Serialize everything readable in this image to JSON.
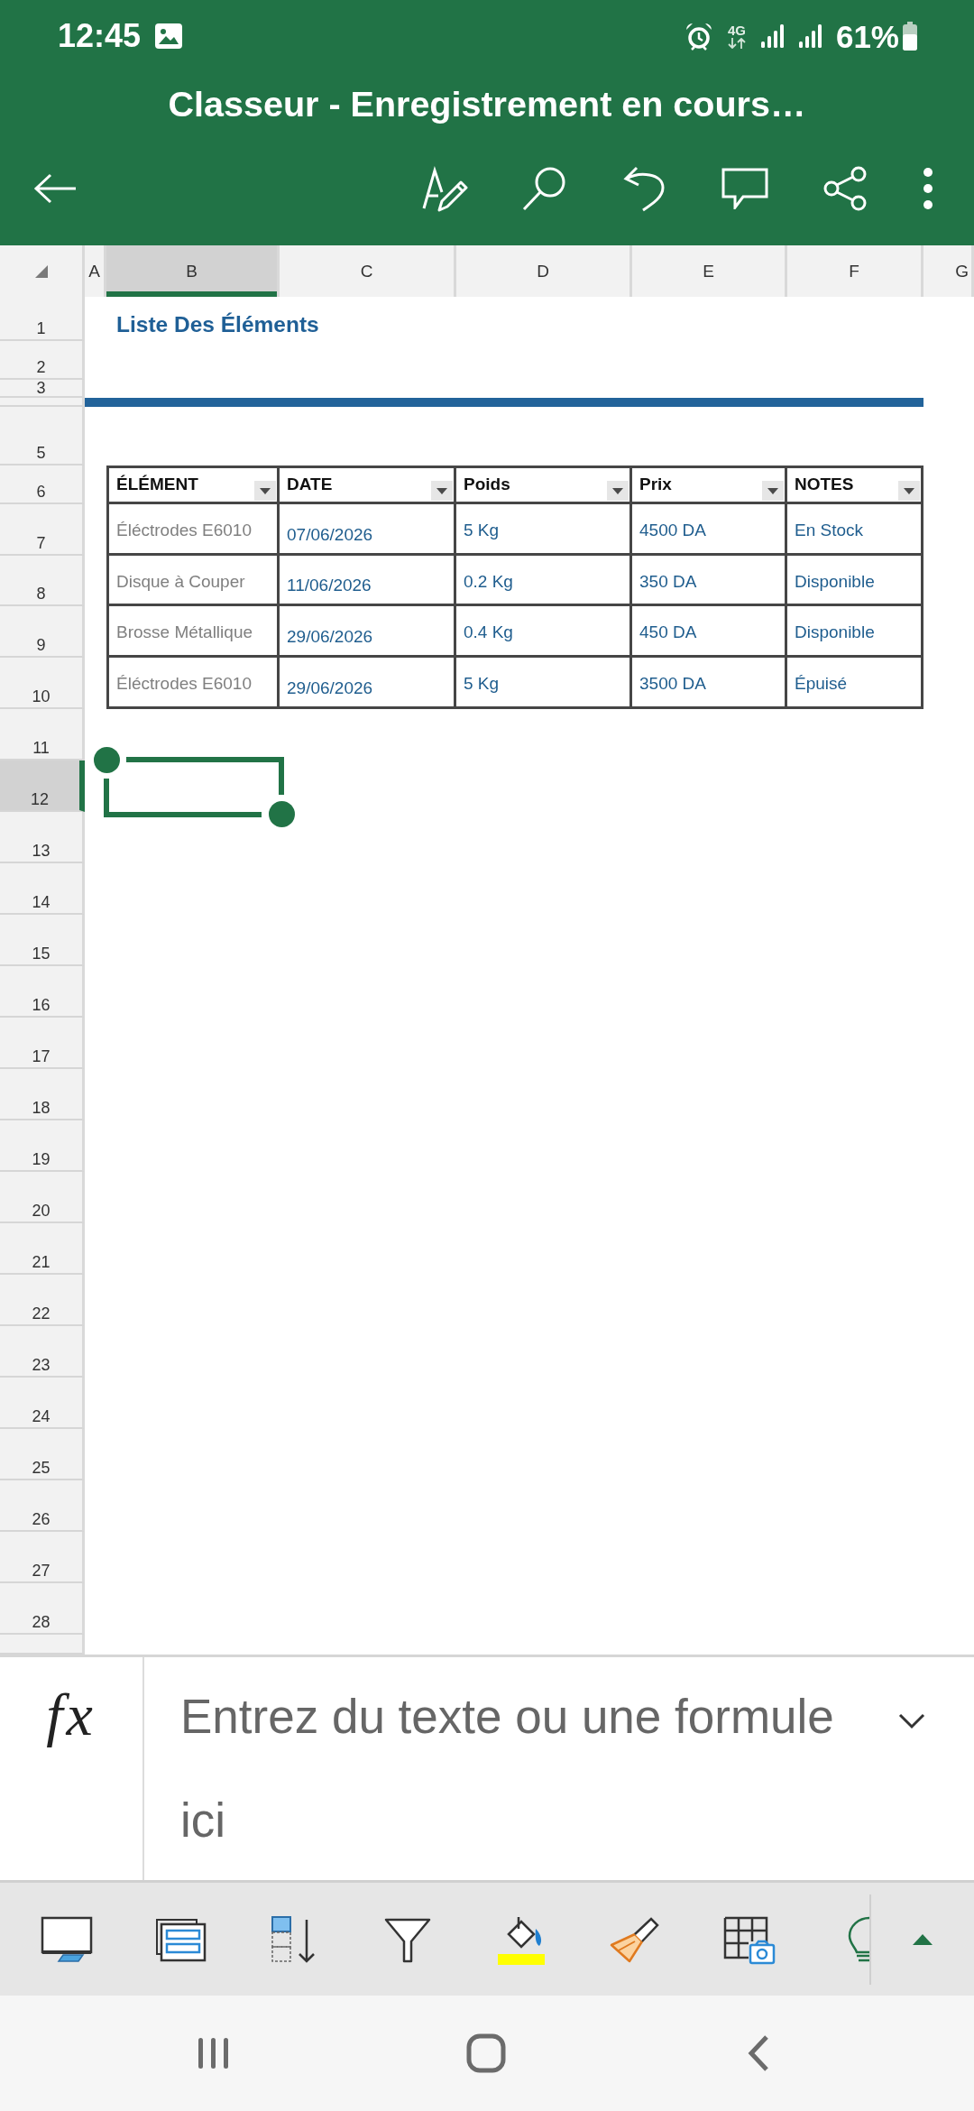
{
  "status_bar": {
    "time": "12:45",
    "network": "4G",
    "battery": "61%"
  },
  "app_bar": {
    "title": "Classeur - Enregistrement en cours…"
  },
  "sheet": {
    "columns": [
      {
        "label": "A",
        "selected": false
      },
      {
        "label": "B",
        "selected": true
      },
      {
        "label": "C",
        "selected": false
      },
      {
        "label": "D",
        "selected": false
      },
      {
        "label": "E",
        "selected": false
      },
      {
        "label": "F",
        "selected": false
      },
      {
        "label": "G",
        "selected": false
      }
    ],
    "rows": [
      {
        "label": "1",
        "selected": false
      },
      {
        "label": "2",
        "selected": false
      },
      {
        "label": "3",
        "selected": false
      },
      {
        "label": "5",
        "selected": false
      },
      {
        "label": "6",
        "selected": false
      },
      {
        "label": "7",
        "selected": false
      },
      {
        "label": "8",
        "selected": false
      },
      {
        "label": "9",
        "selected": false
      },
      {
        "label": "10",
        "selected": false
      },
      {
        "label": "11",
        "selected": false
      },
      {
        "label": "12",
        "selected": true
      },
      {
        "label": "13",
        "selected": false
      },
      {
        "label": "14",
        "selected": false
      },
      {
        "label": "15",
        "selected": false
      },
      {
        "label": "16",
        "selected": false
      },
      {
        "label": "17",
        "selected": false
      },
      {
        "label": "18",
        "selected": false
      },
      {
        "label": "19",
        "selected": false
      },
      {
        "label": "20",
        "selected": false
      },
      {
        "label": "21",
        "selected": false
      },
      {
        "label": "22",
        "selected": false
      },
      {
        "label": "23",
        "selected": false
      },
      {
        "label": "24",
        "selected": false
      },
      {
        "label": "25",
        "selected": false
      },
      {
        "label": "26",
        "selected": false
      },
      {
        "label": "27",
        "selected": false
      },
      {
        "label": "28",
        "selected": false
      }
    ],
    "title": "Liste Des Éléments",
    "table": {
      "columns": [
        "ÉLÉMENT",
        "DATE",
        "Poids",
        "Prix",
        "NOTES"
      ],
      "rows": [
        [
          "Éléctrodes E6010",
          "07/06/2026",
          "5 Kg",
          "4500 DA",
          "En Stock"
        ],
        [
          "Disque à Couper",
          "11/06/2026",
          "0.2 Kg",
          "350 DA",
          "Disponible"
        ],
        [
          "Brosse Métallique",
          "29/06/2026",
          "0.4 Kg",
          "450 DA",
          "Disponible"
        ],
        [
          "Éléctrodes E6010",
          "29/06/2026",
          "5 Kg",
          "3500 DA",
          "Épuisé"
        ]
      ]
    }
  },
  "formula_bar": {
    "button": "fx",
    "placeholder": "Entrez du texte ou une formule ici"
  }
}
